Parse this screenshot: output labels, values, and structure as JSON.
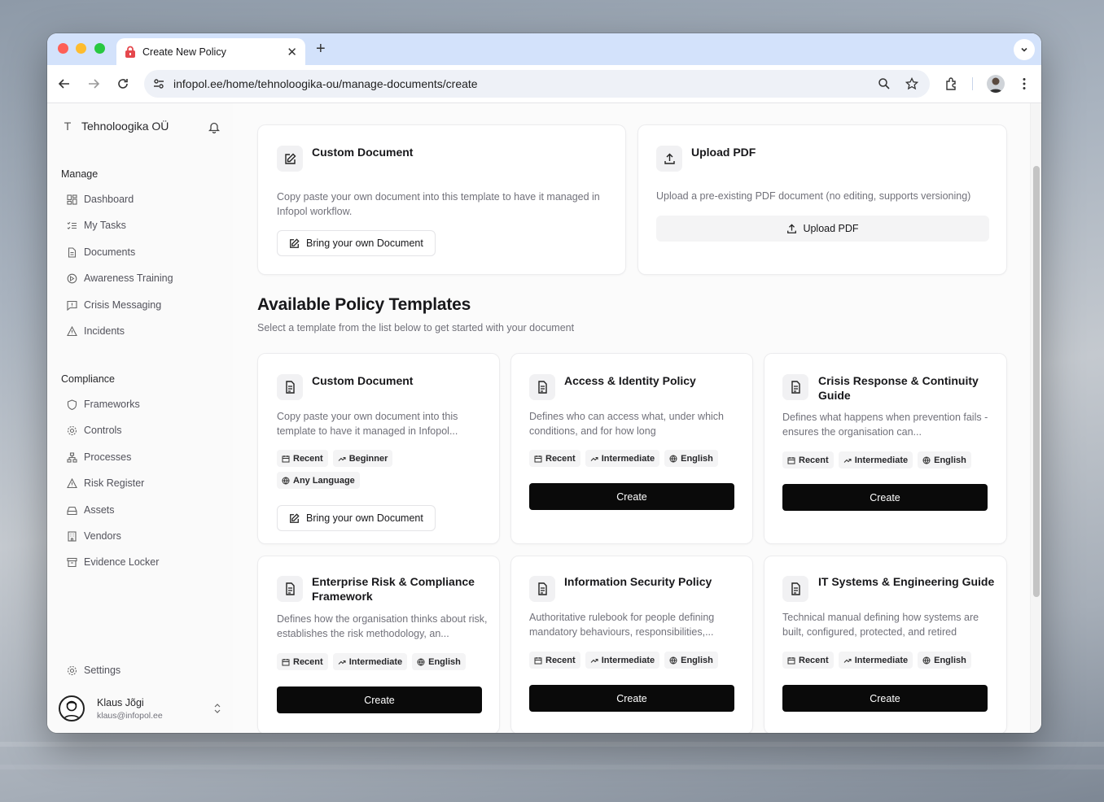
{
  "browser": {
    "tab_title": "Create New Policy",
    "url": "infopol.ee/home/tehnoloogika-ou/manage-documents/create"
  },
  "sidebar": {
    "org_initial": "T",
    "org_name": "Tehnoloogika OÜ",
    "manage_label": "Manage",
    "manage_items": [
      {
        "label": "Dashboard",
        "icon": "dashboard-icon"
      },
      {
        "label": "My Tasks",
        "icon": "list-check-icon"
      },
      {
        "label": "Documents",
        "icon": "file-icon"
      },
      {
        "label": "Awareness Training",
        "icon": "training-icon"
      },
      {
        "label": "Crisis Messaging",
        "icon": "message-alert-icon"
      },
      {
        "label": "Incidents",
        "icon": "warning-icon"
      }
    ],
    "compliance_label": "Compliance",
    "compliance_items": [
      {
        "label": "Frameworks",
        "icon": "shield-icon"
      },
      {
        "label": "Controls",
        "icon": "gear-icon"
      },
      {
        "label": "Processes",
        "icon": "workflow-icon"
      },
      {
        "label": "Risk Register",
        "icon": "warning-icon"
      },
      {
        "label": "Assets",
        "icon": "hard-drive-icon"
      },
      {
        "label": "Vendors",
        "icon": "building-icon"
      },
      {
        "label": "Evidence Locker",
        "icon": "archive-icon"
      }
    ],
    "settings_label": "Settings",
    "user": {
      "name": "Klaus Jõgi",
      "email": "klaus@infopol.ee"
    }
  },
  "top_cards": {
    "custom": {
      "title": "Custom Document",
      "description": "Copy paste your own document into this template to have it managed in Infopol workflow.",
      "button": "Bring your own Document"
    },
    "upload": {
      "title": "Upload PDF",
      "description": "Upload a pre-existing PDF document (no editing, supports versioning)",
      "button": "Upload PDF"
    }
  },
  "templates_section": {
    "heading": "Available Policy Templates",
    "subheading": "Select a template from the list below to get started with your document"
  },
  "templates": [
    {
      "title": "Custom Document",
      "description": "Copy paste your own document into this template to have it managed in Infopol...",
      "badges": [
        "Recent",
        "Beginner",
        "Any Language"
      ],
      "button": "Bring your own Document"
    },
    {
      "title": "Access & Identity Policy",
      "description": "Defines who can access what, under which conditions, and for how long",
      "badges": [
        "Recent",
        "Intermediate",
        "English"
      ],
      "button": "Create"
    },
    {
      "title": "Crisis Response & Continuity Guide",
      "description": "Defines what happens when prevention fails - ensures the organisation can...",
      "badges": [
        "Recent",
        "Intermediate",
        "English"
      ],
      "button": "Create"
    },
    {
      "title": "Enterprise Risk & Compliance Framework",
      "description": "Defines how the organisation thinks about risk, establishes the risk methodology, an...",
      "badges": [
        "Recent",
        "Intermediate",
        "English"
      ],
      "button": "Create"
    },
    {
      "title": "Information Security Policy",
      "description": "Authoritative rulebook for people defining mandatory behaviours, responsibilities,...",
      "badges": [
        "Recent",
        "Intermediate",
        "English"
      ],
      "button": "Create"
    },
    {
      "title": "IT Systems & Engineering Guide",
      "description": "Technical manual defining how systems are built, configured, protected, and retired",
      "badges": [
        "Recent",
        "Intermediate",
        "English"
      ],
      "button": "Create"
    }
  ]
}
